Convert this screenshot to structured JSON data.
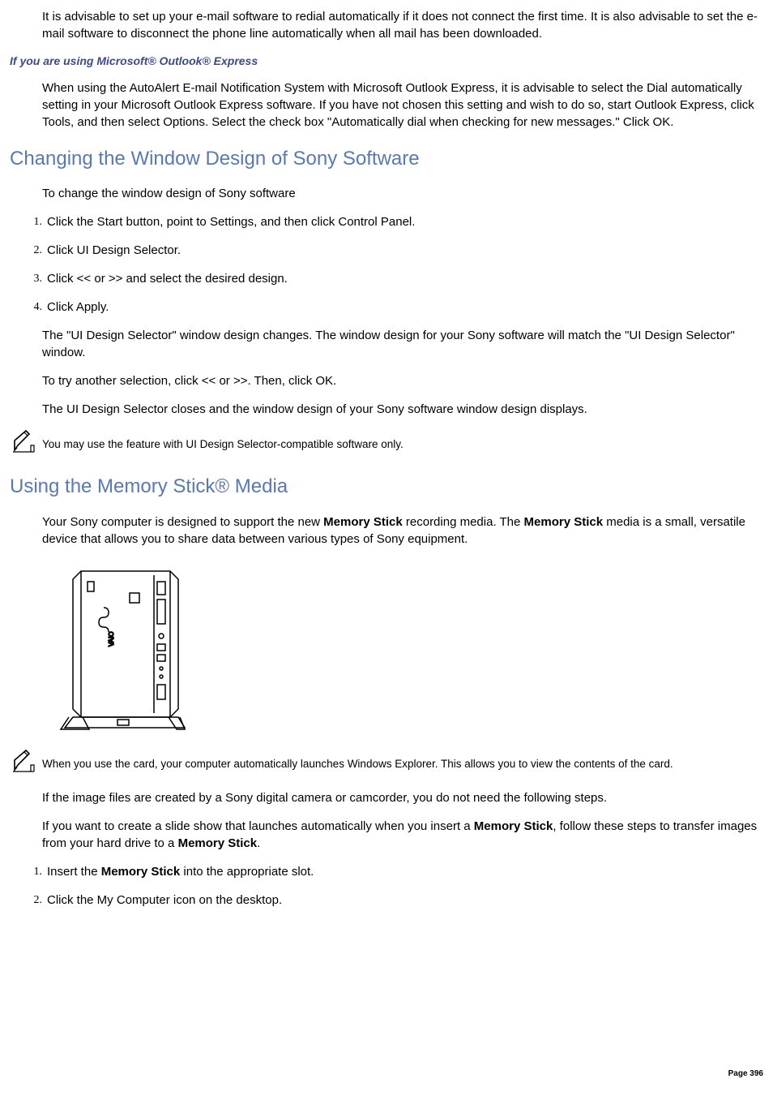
{
  "intro_para": "It is advisable to set up your e-mail software to redial automatically if it does not connect the first time. It is also advisable to set the e-mail software to disconnect the phone line automatically when all mail has been downloaded.",
  "outlook_heading": "If you are using Microsoft® Outlook® Express",
  "outlook_para": "When using the AutoAlert E-mail Notification System with Microsoft Outlook Express, it is advisable to select the Dial automatically setting in your Microsoft Outlook Express software. If you have not chosen this setting and wish to do so, start Outlook Express, click Tools, and then select Options. Select the check box \"Automatically dial when checking for new messages.\" Click OK.",
  "window_design": {
    "heading": "Changing the Window Design of Sony Software",
    "intro": "To change the window design of Sony software",
    "steps": [
      "Click the Start button, point to Settings, and then click Control Panel.",
      "Click UI Design Selector.",
      "Click << or >> and select the desired design.",
      "Click Apply."
    ],
    "after1": "The \"UI Design Selector\" window design changes. The window design for your Sony software will match the \"UI Design Selector\" window.",
    "after2": "To try another selection, click << or >>. Then, click OK.",
    "after3": "The UI Design Selector closes and the window design of your Sony software window design displays.",
    "note": "You may use the feature with UI Design Selector-compatible software only."
  },
  "memory_stick": {
    "heading": "Using the Memory Stick® Media",
    "intro_pre": "Your Sony computer is designed to support the new ",
    "intro_bold1": "Memory Stick",
    "intro_mid": " recording media. The ",
    "intro_bold2": "Memory Stick",
    "intro_post": " media is a small, versatile device that allows you to share data between various types of Sony equipment.",
    "note": "When you use the card, your computer automatically launches Windows Explorer. This allows you to view the contents of the card.",
    "para2": "If the image files are created by a Sony digital camera or camcorder, you do not need the following steps.",
    "para3_pre": "If you want to create a slide show that launches automatically when you insert a ",
    "para3_bold1": "Memory Stick",
    "para3_mid": ", follow these steps to transfer images from your hard drive to a ",
    "para3_bold2": "Memory Stick",
    "para3_post": ".",
    "step1_pre": "Insert the ",
    "step1_bold": "Memory Stick",
    "step1_post": " into the appropriate slot.",
    "step2": "Click the My Computer icon on the desktop."
  },
  "page_label": "Page 396",
  "numbers": {
    "n1": "1.",
    "n2": "2.",
    "n3": "3.",
    "n4": "4."
  }
}
